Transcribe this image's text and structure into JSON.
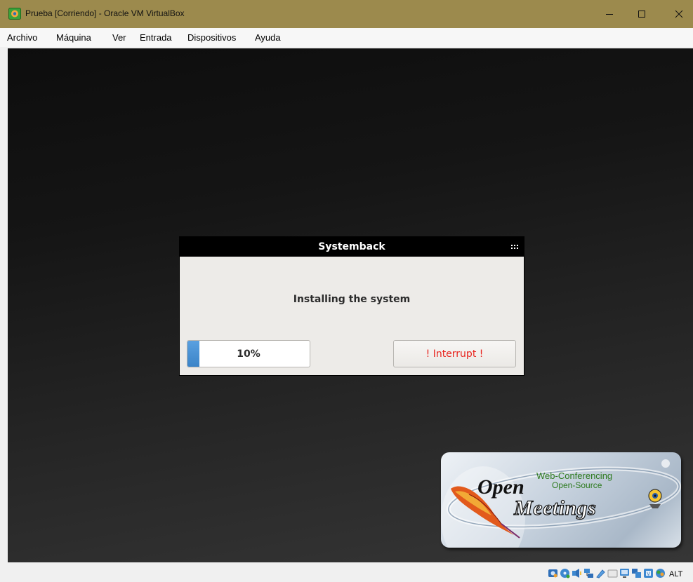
{
  "window": {
    "title": "Prueba [Corriendo] - Oracle VM VirtualBox",
    "icon": "virtualbox-icon",
    "controls": [
      "minimize-icon",
      "maximize-icon",
      "close-icon"
    ]
  },
  "menu": {
    "items": [
      "Archivo",
      "Máquina",
      "Ver",
      "Entrada",
      "Dispositivos",
      "Ayuda"
    ]
  },
  "dialog": {
    "title": "Systemback",
    "menu_icon": "dots-grid-icon",
    "message": "Installing the system",
    "progress": {
      "percent": 10,
      "label": "10%"
    },
    "interrupt_label": "! Interrupt !"
  },
  "logo": {
    "open": "Open",
    "meetings": "Meetings",
    "tagline1": "Web-Conferencing",
    "tagline2": "Open-Source"
  },
  "statusbar": {
    "icons": [
      "hard-disk-icon",
      "optical-disk-icon",
      "audio-icon",
      "network-icon",
      "usb-icon",
      "shared-folders-icon",
      "display-icon",
      "video-capture-icon",
      "recording-icon",
      "guest-additions-icon",
      "keyboard-capture-icon"
    ],
    "host_key": "ALT"
  },
  "colors": {
    "titlebar": "#9c8a4d",
    "progress_fill": "#3b84c8",
    "interrupt_text": "#e8241e"
  }
}
